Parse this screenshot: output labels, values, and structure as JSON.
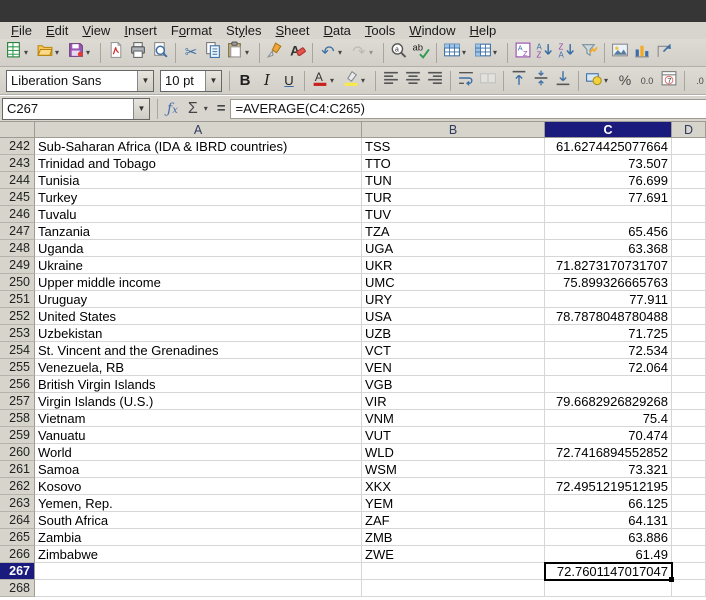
{
  "menubar": {
    "items": [
      {
        "label": "File",
        "mnemonic_index": 0
      },
      {
        "label": "Edit",
        "mnemonic_index": 0
      },
      {
        "label": "View",
        "mnemonic_index": 0
      },
      {
        "label": "Insert",
        "mnemonic_index": 0
      },
      {
        "label": "Format",
        "mnemonic_index": 1
      },
      {
        "label": "Styles",
        "mnemonic_index": 2
      },
      {
        "label": "Sheet",
        "mnemonic_index": 0
      },
      {
        "label": "Data",
        "mnemonic_index": 0
      },
      {
        "label": "Tools",
        "mnemonic_index": 0
      },
      {
        "label": "Window",
        "mnemonic_index": 0
      },
      {
        "label": "Help",
        "mnemonic_index": 0
      }
    ]
  },
  "toolbar_standard": {
    "buttons": [
      {
        "icon": "new-document-icon",
        "dropdown": true
      },
      {
        "icon": "open-icon",
        "dropdown": true
      },
      {
        "icon": "save-icon",
        "dropdown": true
      },
      {
        "separator": true
      },
      {
        "icon": "export-pdf-icon"
      },
      {
        "icon": "print-icon"
      },
      {
        "icon": "print-preview-icon"
      },
      {
        "separator": true
      },
      {
        "icon": "cut-icon"
      },
      {
        "icon": "copy-icon"
      },
      {
        "icon": "paste-icon",
        "dropdown": true
      },
      {
        "separator": true
      },
      {
        "icon": "clone-formatting-icon"
      },
      {
        "icon": "clear-formatting-icon"
      },
      {
        "separator": true
      },
      {
        "icon": "undo-icon",
        "dropdown": true
      },
      {
        "icon": "redo-icon",
        "dropdown": true,
        "disabled": true
      },
      {
        "separator": true
      },
      {
        "icon": "find-replace-icon"
      },
      {
        "icon": "spelling-icon"
      },
      {
        "separator": true
      },
      {
        "icon": "insert-rows-icon",
        "dropdown": true
      },
      {
        "icon": "insert-columns-icon",
        "dropdown": true
      },
      {
        "separator": true
      },
      {
        "icon": "sort-icon"
      },
      {
        "icon": "sort-ascending-icon"
      },
      {
        "icon": "sort-descending-icon"
      },
      {
        "icon": "autofilter-icon"
      },
      {
        "separator": true
      },
      {
        "icon": "insert-image-icon"
      },
      {
        "icon": "insert-chart-icon"
      },
      {
        "icon": "freeze-panes-icon"
      }
    ]
  },
  "toolbar_formatting": {
    "font_name": "Liberation Sans",
    "font_size": "10 pt",
    "buttons": [
      {
        "icon": "bold-icon"
      },
      {
        "icon": "italic-icon"
      },
      {
        "icon": "underline-icon"
      },
      {
        "separator": true
      },
      {
        "icon": "font-color-icon",
        "dropdown": true
      },
      {
        "icon": "highlighting-color-icon",
        "dropdown": true
      },
      {
        "separator": true
      },
      {
        "icon": "align-left-icon"
      },
      {
        "icon": "align-center-icon"
      },
      {
        "icon": "align-right-icon"
      },
      {
        "separator": true
      },
      {
        "icon": "wrap-text-icon"
      },
      {
        "icon": "merge-cells-icon",
        "disabled": true
      },
      {
        "separator": true
      },
      {
        "icon": "align-top-icon"
      },
      {
        "icon": "center-vertically-icon"
      },
      {
        "icon": "align-bottom-icon"
      },
      {
        "separator": true
      },
      {
        "icon": "format-currency-icon",
        "dropdown": true
      },
      {
        "icon": "format-percent-icon"
      },
      {
        "icon": "format-number-icon"
      },
      {
        "icon": "format-date-icon"
      },
      {
        "separator": true
      },
      {
        "icon": "delete-decimal-icon"
      }
    ]
  },
  "formula_bar": {
    "cell_reference": "C267",
    "formula": "=AVERAGE(C4:C265)"
  },
  "spreadsheet": {
    "column_headers": [
      "A",
      "B",
      "C",
      "D"
    ],
    "selected_column": "C",
    "selected_row": 267,
    "active_cell": {
      "reference": "C267",
      "value": "72.7601147017047"
    },
    "rows": [
      {
        "n": 242,
        "name": "Sub-Saharan Africa (IDA & IBRD countries)",
        "code": "TSS",
        "value": "61.6274425077664",
        "code_misspelled": true,
        "name_misspelled_word": "IBRD"
      },
      {
        "n": 243,
        "name": "Trinidad and Tobago",
        "code": "TTO",
        "value": "73.507",
        "code_misspelled": true
      },
      {
        "n": 244,
        "name": "Tunisia",
        "code": "TUN",
        "value": "76.699",
        "code_misspelled": false
      },
      {
        "n": 245,
        "name": "Turkey",
        "code": "TUR",
        "value": "77.691",
        "code_misspelled": false
      },
      {
        "n": 246,
        "name": "Tuvalu",
        "code": "TUV",
        "value": "",
        "code_misspelled": true
      },
      {
        "n": 247,
        "name": "Tanzania",
        "code": "TZA",
        "value": "65.456",
        "code_misspelled": true
      },
      {
        "n": 248,
        "name": "Uganda",
        "code": "UGA",
        "value": "63.368",
        "code_misspelled": true
      },
      {
        "n": 249,
        "name": "Ukraine",
        "code": "UKR",
        "value": "71.8273170731707",
        "code_misspelled": true
      },
      {
        "n": 250,
        "name": "Upper middle income",
        "code": "UMC",
        "value": "75.899326665763",
        "code_misspelled": true
      },
      {
        "n": 251,
        "name": "Uruguay",
        "code": "URY",
        "value": "77.911",
        "code_misspelled": true
      },
      {
        "n": 252,
        "name": "United States",
        "code": "USA",
        "value": "78.7878048780488",
        "code_misspelled": false
      },
      {
        "n": 253,
        "name": "Uzbekistan",
        "code": "UZB",
        "value": "71.725",
        "code_misspelled": true
      },
      {
        "n": 254,
        "name": "St. Vincent and the Grenadines",
        "code": "VCT",
        "value": "72.534",
        "code_misspelled": true
      },
      {
        "n": 255,
        "name": "Venezuela, RB",
        "code": "VEN",
        "value": "72.064",
        "code_misspelled": false
      },
      {
        "n": 256,
        "name": "British Virgin Islands",
        "code": "VGB",
        "value": "",
        "code_misspelled": true
      },
      {
        "n": 257,
        "name": "Virgin Islands (U.S.)",
        "code": "VIR",
        "value": "79.6682926829268",
        "code_misspelled": true
      },
      {
        "n": 258,
        "name": "Vietnam",
        "code": "VNM",
        "value": "75.4",
        "code_misspelled": true
      },
      {
        "n": 259,
        "name": "Vanuatu",
        "code": "VUT",
        "value": "70.474",
        "code_misspelled": true
      },
      {
        "n": 260,
        "name": "World",
        "code": "WLD",
        "value": "72.7416894552852",
        "code_misspelled": true
      },
      {
        "n": 261,
        "name": "Samoa",
        "code": "WSM",
        "value": "73.321",
        "code_misspelled": true
      },
      {
        "n": 262,
        "name": "Kosovo",
        "code": "XKX",
        "value": "72.4951219512195",
        "code_misspelled": true
      },
      {
        "n": 263,
        "name": "Yemen, Rep.",
        "code": "YEM",
        "value": "66.125",
        "code_misspelled": true
      },
      {
        "n": 264,
        "name": "South Africa",
        "code": "ZAF",
        "value": "64.131",
        "code_misspelled": true
      },
      {
        "n": 265,
        "name": "Zambia",
        "code": "ZMB",
        "value": "63.886",
        "code_misspelled": true
      },
      {
        "n": 266,
        "name": "Zimbabwe",
        "code": "ZWE",
        "value": "61.49",
        "code_misspelled": true
      },
      {
        "n": 267,
        "name": "",
        "code": "",
        "value": "72.7601147017047",
        "selected": true
      },
      {
        "n": 268,
        "name": "",
        "code": "",
        "value": ""
      }
    ]
  },
  "colors": {
    "selected_header_bg": "#1b1b7e",
    "squiggle_red": "#e03a3a",
    "accent_blue": "#3a6ea5",
    "titlebar_bg": "#363636"
  }
}
